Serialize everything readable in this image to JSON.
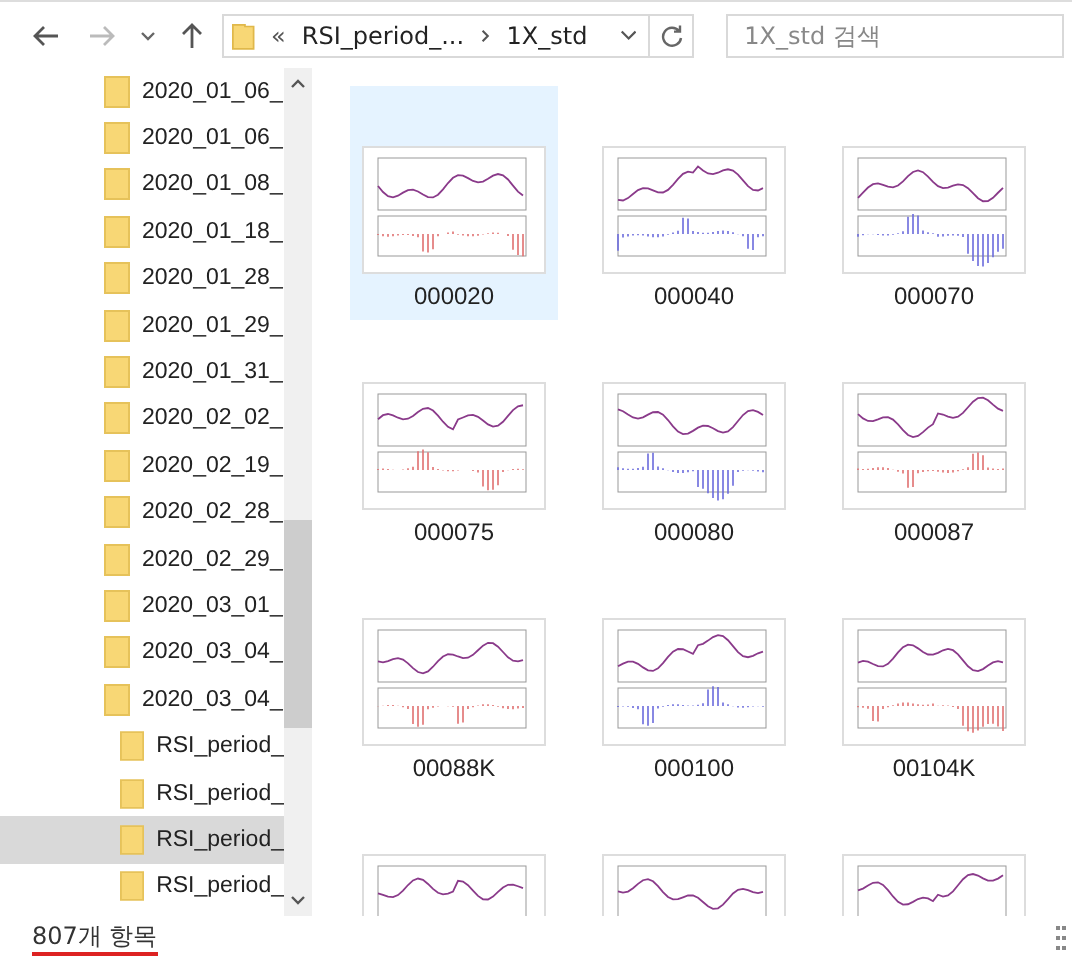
{
  "toolbar": {
    "address": {
      "overflow": "«",
      "crumbs": [
        "RSI_period_...",
        "1X_std"
      ]
    },
    "search": {
      "placeholder": "1X_std 검색"
    }
  },
  "nav": {
    "items": [
      {
        "name": "2020_01_06_",
        "selected": false
      },
      {
        "name": "2020_01_06_",
        "selected": false
      },
      {
        "name": "2020_01_08_",
        "selected": false
      },
      {
        "name": "2020_01_18_",
        "selected": false
      },
      {
        "name": "2020_01_28_",
        "selected": false
      },
      {
        "name": "2020_01_29_",
        "selected": false
      },
      {
        "name": "2020_01_31_",
        "selected": false
      },
      {
        "name": "2020_02_02_",
        "selected": false
      },
      {
        "name": "2020_02_19_",
        "selected": false
      },
      {
        "name": "2020_02_28_",
        "selected": false
      },
      {
        "name": "2020_02_29_",
        "selected": false
      },
      {
        "name": "2020_03_01_",
        "selected": false
      },
      {
        "name": "2020_03_04_",
        "selected": false
      },
      {
        "name": "2020_03_04_",
        "selected": false,
        "children": [
          {
            "name": "RSI_period_",
            "selected": false
          },
          {
            "name": "RSI_period_",
            "selected": false
          },
          {
            "name": "RSI_period_",
            "selected": true
          },
          {
            "name": "RSI_period_",
            "selected": false
          }
        ]
      }
    ]
  },
  "files": [
    {
      "name": "000020",
      "selected": true
    },
    {
      "name": "000040",
      "selected": false
    },
    {
      "name": "000070",
      "selected": false
    },
    {
      "name": "000075",
      "selected": false
    },
    {
      "name": "000080",
      "selected": false
    },
    {
      "name": "000087",
      "selected": false
    },
    {
      "name": "00088K",
      "selected": false
    },
    {
      "name": "000100",
      "selected": false
    },
    {
      "name": "00104K",
      "selected": false
    },
    {
      "selected": false
    },
    {
      "selected": false
    },
    {
      "selected": false
    }
  ],
  "status_bar": {
    "count": "807개 항목"
  }
}
